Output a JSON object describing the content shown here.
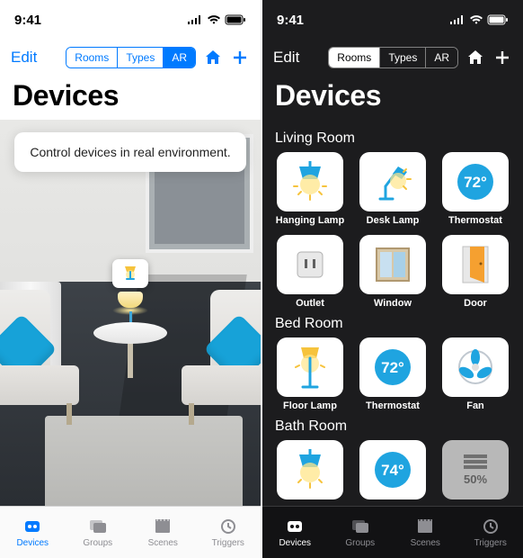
{
  "status": {
    "time": "9:41"
  },
  "nav": {
    "edit": "Edit",
    "segments": [
      "Rooms",
      "Types",
      "AR"
    ]
  },
  "title": "Devices",
  "ar": {
    "tooltip": "Control devices in real environment."
  },
  "rooms": [
    {
      "name": "Living Room",
      "devices": [
        {
          "label": "Hanging Lamp",
          "icon": "hanging-lamp"
        },
        {
          "label": "Desk Lamp",
          "icon": "desk-lamp"
        },
        {
          "label": "Thermostat",
          "icon": "thermostat",
          "value": "72°"
        },
        {
          "label": "Outlet",
          "icon": "outlet"
        },
        {
          "label": "Window",
          "icon": "window"
        },
        {
          "label": "Door",
          "icon": "door"
        }
      ]
    },
    {
      "name": "Bed Room",
      "devices": [
        {
          "label": "Floor Lamp",
          "icon": "floor-lamp"
        },
        {
          "label": "Thermostat",
          "icon": "thermostat",
          "value": "72°"
        },
        {
          "label": "Fan",
          "icon": "fan"
        }
      ]
    },
    {
      "name": "Bath Room",
      "devices": [
        {
          "label": "",
          "icon": "hanging-lamp"
        },
        {
          "label": "",
          "icon": "thermostat",
          "value": "74°"
        },
        {
          "label": "",
          "icon": "blinds",
          "value": "50%",
          "dim": true
        }
      ]
    }
  ],
  "tabs": [
    {
      "label": "Devices",
      "icon": "devices"
    },
    {
      "label": "Groups",
      "icon": "groups"
    },
    {
      "label": "Scenes",
      "icon": "scenes"
    },
    {
      "label": "Triggers",
      "icon": "triggers"
    }
  ],
  "colors": {
    "accent_light": "#007aff",
    "accent_yellow": "#f6c33c",
    "accent_blue": "#1fa4e0"
  }
}
